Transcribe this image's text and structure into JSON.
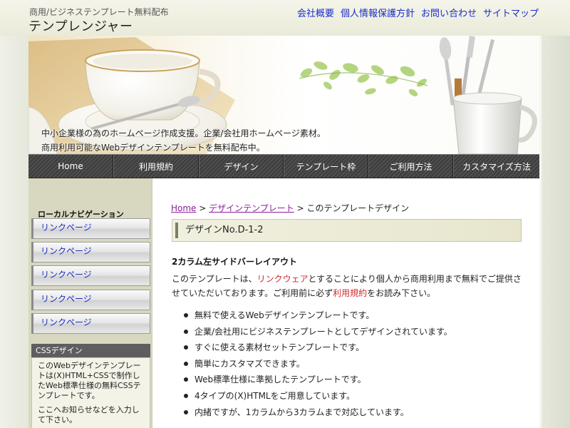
{
  "header": {
    "tagline": "商用/ビジネステンプレート無料配布",
    "logo": "テンプレンジャー",
    "top_links": [
      "会社概要",
      "個人情報保護方針",
      "お問い合わせ",
      "サイトマップ"
    ]
  },
  "hero": {
    "caption_line1": "中小企業様の為のホームページ作成支援。企業/会社用ホームページ素材。",
    "caption_line2": "商用利用可能なWebデザインテンプレートを無料配布中。"
  },
  "global_nav": [
    "Home",
    "利用規約",
    "デザイン",
    "テンプレート枠",
    "ご利用方法",
    "カスタマイズ方法"
  ],
  "sidebar": {
    "local_nav_title": "ローカルナビゲーション",
    "links": [
      "リンクページ",
      "リンクページ",
      "リンクページ",
      "リンクページ",
      "リンクページ"
    ],
    "css_box": {
      "title": "CSSデザイン",
      "text1": "このWebデザインテンプレートは(X)HTML+CSSで制作したWeb標準仕様の無料CSSテンプレートです。",
      "text2": "ここへお知らせなどを入力して下さい。"
    }
  },
  "main": {
    "breadcrumb": {
      "home": "Home",
      "sep1": " > ",
      "design": "デザインテンプレート",
      "sep2": " > ",
      "current": "このテンプレートデザイン"
    },
    "heading": "デザインNo.D-1-2",
    "section_title": "2カラム左サイドバーレイアウト",
    "intro": {
      "part1": "このテンプレートは、",
      "link1": "リンクウェア",
      "part2": "とすることにより個人から商用利用まで無料でご提供させていただいております。ご利用前に必ず",
      "link2": "利用規約",
      "part3": "をお読み下さい。"
    },
    "features": [
      "無料で使えるWebデザインテンプレートです。",
      "企業/会社用にビジネステンプレートとしてデザインされています。",
      "すぐに使える素材セットテンプレートです。",
      "簡単にカスタマズできます。",
      "Web標準仕様に準拠したテンプレートです。",
      "4タイプの(X)HTMLをご用意しています。",
      "内緒ですが、1カラムから3カラムまで対応しています。"
    ]
  },
  "colors": {
    "link_blue": "#1a2cc8",
    "visited_purple": "#8a1e9a",
    "accent_red": "#d42a2a",
    "nav_dark": "#3c3c3c",
    "sidebar_bg": "#d8d7c0"
  }
}
